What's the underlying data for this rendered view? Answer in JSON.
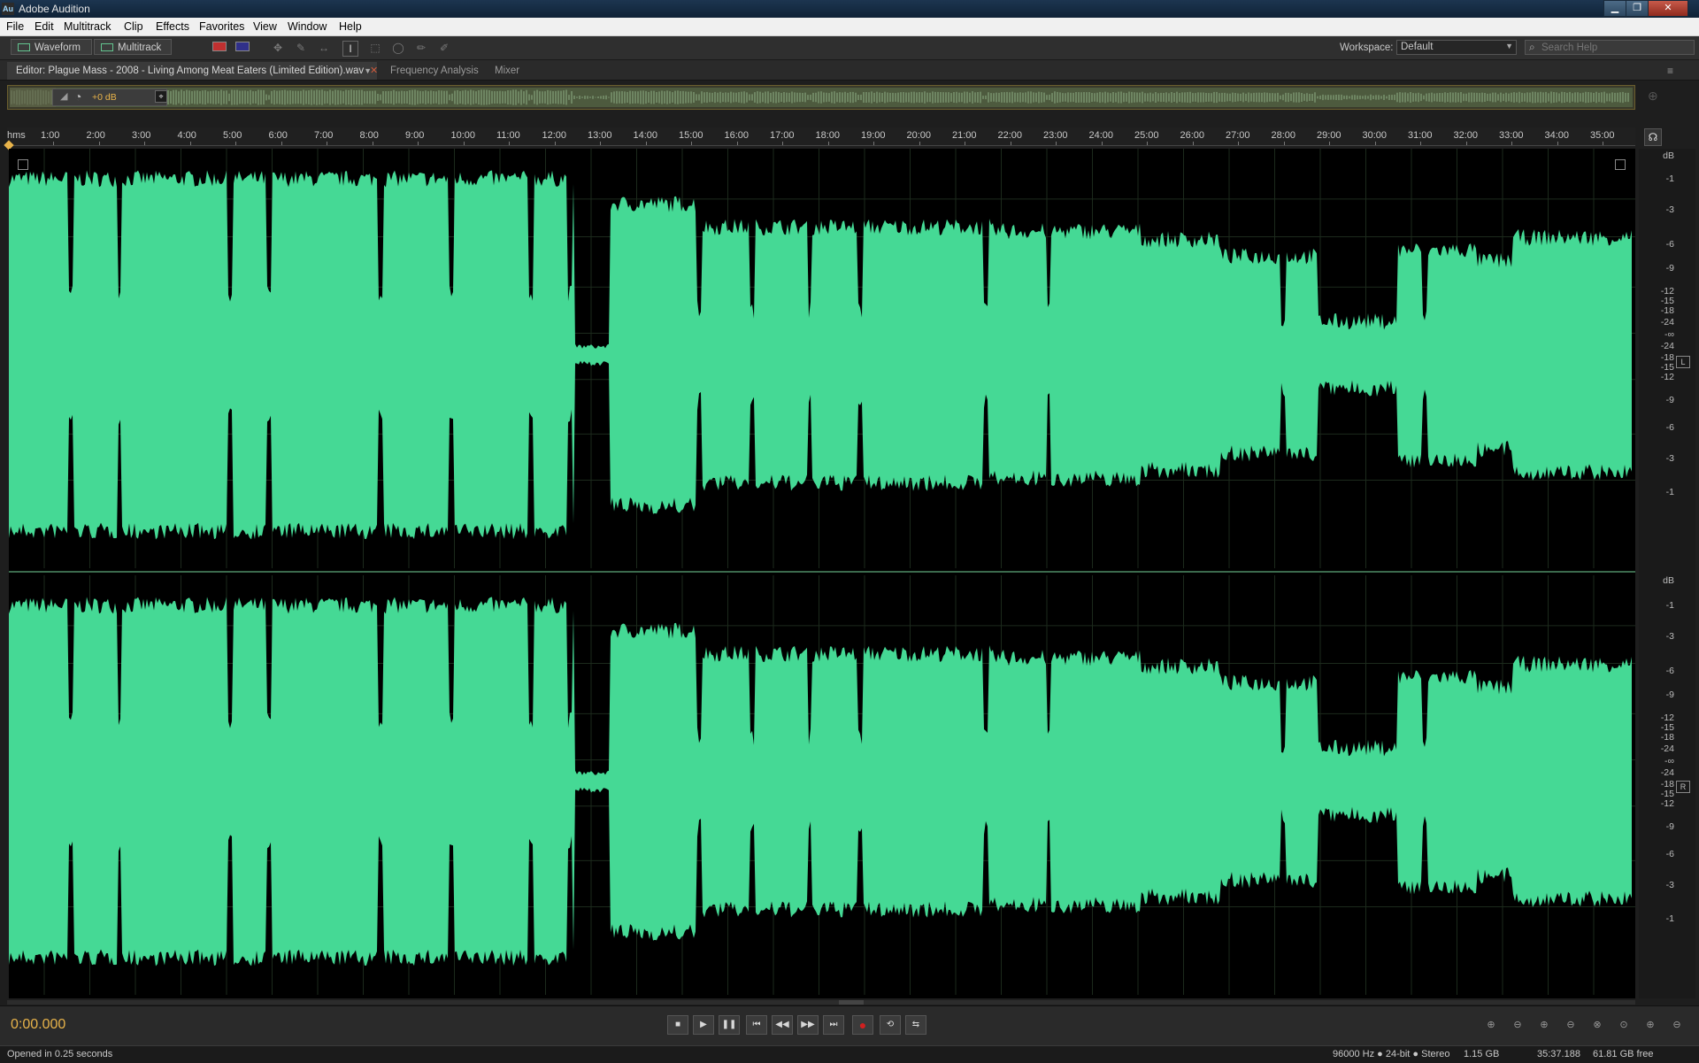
{
  "window": {
    "title": "Adobe Audition",
    "app_icon": "Au"
  },
  "menu": [
    "File",
    "Edit",
    "Multitrack",
    "Clip",
    "Effects",
    "Favorites",
    "View",
    "Window",
    "Help"
  ],
  "toolbar": {
    "waveform_label": "Waveform",
    "multitrack_label": "Multitrack",
    "workspace_label": "Workspace:",
    "workspace_value": "Default",
    "search_placeholder": "Search Help"
  },
  "tabs": {
    "editor": "Editor: Plague Mass - 2008 - Living Among Meat Eaters (Limited Edition).wav",
    "frequency": "Frequency Analysis",
    "mixer": "Mixer"
  },
  "overview": {
    "gain_label": "+0 dB"
  },
  "ruler": {
    "unit": "hms",
    "ticks": [
      "1:00",
      "2:00",
      "3:00",
      "4:00",
      "5:00",
      "6:00",
      "7:00",
      "8:00",
      "9:00",
      "10:00",
      "11:00",
      "12:00",
      "13:00",
      "14:00",
      "15:00",
      "16:00",
      "17:00",
      "18:00",
      "19:00",
      "20:00",
      "21:00",
      "22:00",
      "23:00",
      "24:00",
      "25:00",
      "26:00",
      "27:00",
      "28:00",
      "29:00",
      "30:00",
      "31:00",
      "32:00",
      "33:00",
      "34:00",
      "35:00"
    ]
  },
  "db_scale": {
    "unit": "dB",
    "left_labels": [
      "-1",
      "-3",
      "-6",
      "-9",
      "-12",
      "-15",
      "-18",
      "-24",
      "-∞",
      "-24",
      "-18",
      "-15",
      "-12",
      "-9",
      "-6",
      "-3",
      "-1"
    ],
    "channel_left": "L",
    "channel_right": "R"
  },
  "transport": {
    "time": "0:00.000"
  },
  "status": {
    "message": "Opened in 0.25 seconds",
    "format": "96000 Hz ● 24-bit ● Stereo",
    "file_size": "1.15 GB",
    "duration": "35:37.188",
    "free_space": "61.81 GB free"
  },
  "colors": {
    "waveform": "#45d995",
    "timecode": "#e8b34a",
    "overview_frame": "#6b5e2e"
  }
}
